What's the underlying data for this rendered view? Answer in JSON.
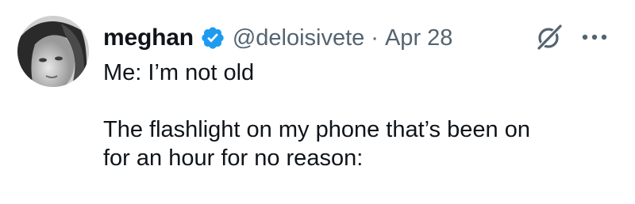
{
  "author": {
    "display_name": "meghan",
    "handle": "@deloisivete",
    "separator": "·",
    "date": "Apr 28"
  },
  "tweet": {
    "lines": [
      "Me: I’m not old",
      "",
      "The flashlight on my phone that’s been on",
      "for an hour for no reason:"
    ]
  },
  "icons": {
    "verified": "verified-badge-icon",
    "grok": "grok-icon",
    "more": "more-options-icon"
  },
  "colors": {
    "verified_blue": "#1d9bf0",
    "secondary_text": "#536471",
    "primary_text": "#0f1419"
  }
}
